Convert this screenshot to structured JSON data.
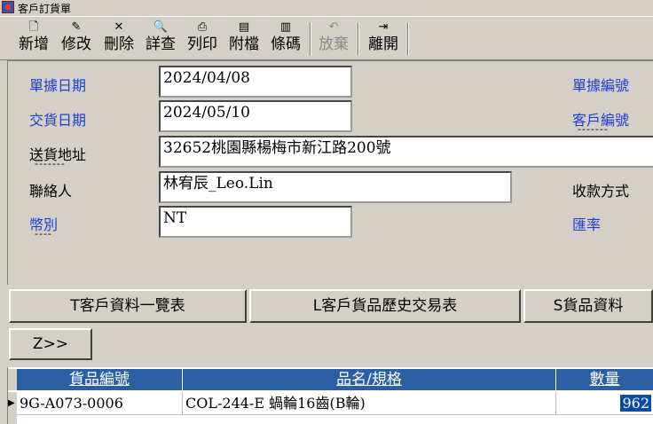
{
  "window": {
    "title": "客戶訂貨單"
  },
  "toolbar": {
    "buttons": [
      {
        "label": "新增",
        "icon": "new-document-icon",
        "glyph": "🗋"
      },
      {
        "label": "修改",
        "icon": "edit-icon",
        "glyph": "✎"
      },
      {
        "label": "刪除",
        "icon": "delete-icon",
        "glyph": "✕"
      },
      {
        "label": "詳查",
        "icon": "search-icon",
        "glyph": "🔍"
      },
      {
        "label": "列印",
        "icon": "printer-icon",
        "glyph": "⎙"
      },
      {
        "label": "附檔",
        "icon": "attachment-icon",
        "glyph": "▤"
      },
      {
        "label": "條碼",
        "icon": "barcode-icon",
        "glyph": "▥"
      },
      {
        "label": "放棄",
        "icon": "undo-icon",
        "glyph": "↶"
      },
      {
        "label": "離開",
        "icon": "exit-icon",
        "glyph": "⇥"
      }
    ]
  },
  "form": {
    "order_date_label": "單據日期",
    "order_date_value": "2024/04/08",
    "order_no_label": "單據編號",
    "delivery_date_label": "交貨日期",
    "delivery_date_value": "2024/05/10",
    "customer_no_label": "客戶編號",
    "address_label": "送貨地址",
    "address_value": "32652桃園縣楊梅市新江路200號",
    "contact_label": "聯絡人",
    "contact_value": "林宥辰_Leo.Lin",
    "payment_label": "收款方式",
    "currency_label": "幣別",
    "currency_value": "NT",
    "rate_label": "匯率",
    "underline_mark": "-------",
    "underline_mark_short": "----"
  },
  "buttons": {
    "customer_list": "T客戶資料一覽表",
    "customer_history": "L客戶貨品歷史交易表",
    "goods_data": "S貨品資料",
    "z_button": "Z>>"
  },
  "grid": {
    "columns": [
      "貨品編號",
      "品名/規格",
      "數量"
    ],
    "rows": [
      {
        "item_no": "9G-A073-0006",
        "name": "COL-244-E 蝸輪16齒(B輪)",
        "qty": "962"
      }
    ]
  },
  "colors": {
    "label_blue": "#1f3fd1",
    "grid_header": "#2a5fa4",
    "selection": "#0a4ba8"
  }
}
